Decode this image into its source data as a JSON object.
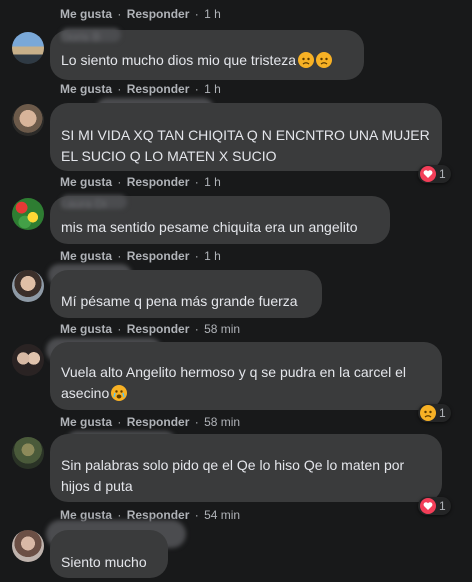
{
  "ui": {
    "like": "Me gusta",
    "reply": "Responder",
    "dot": "·"
  },
  "colors": {
    "background": "#18191a",
    "bubble": "#3a3b3c",
    "meta": "#b0b3b8",
    "heart": "#f33e58",
    "sad": "#f7b125"
  },
  "top_meta": {
    "time": "1 h"
  },
  "comments": [
    {
      "name": "Doris B",
      "text": "Lo siento mucho dios mio que tristeza",
      "time": "1 h",
      "reaction": null
    },
    {
      "name": "",
      "text": "SI MI VIDA XQ TAN CHIQITA Q N ENCNTRO UNA MUJER\nEL SUCIO Q LO MATEN X SUCIO",
      "time": "1 h",
      "reaction": {
        "icon": "heart-icon",
        "count": "1"
      }
    },
    {
      "name": "Laura Di",
      "text": "mis ma sentido pesame chiquita era un angelito",
      "time": "1 h",
      "reaction": null
    },
    {
      "name": "",
      "text": "Mí pésame q pena más grande fuerza",
      "time": "58 min",
      "reaction": null
    },
    {
      "name": "",
      "text": "Vuela alto Angelito hermoso y q se pudra en la carcel el\nasecino",
      "time": "58 min",
      "reaction": {
        "icon": "sad-icon",
        "count": "1"
      }
    },
    {
      "name": "",
      "text": "Sin palabras solo pido qe el Qe lo hiso Qe lo maten por\nhijos d puta",
      "time": "54 min",
      "reaction": {
        "icon": "heart-icon",
        "count": "1"
      }
    },
    {
      "name": "",
      "text": "Siento mucho",
      "time": "",
      "reaction": null
    }
  ]
}
